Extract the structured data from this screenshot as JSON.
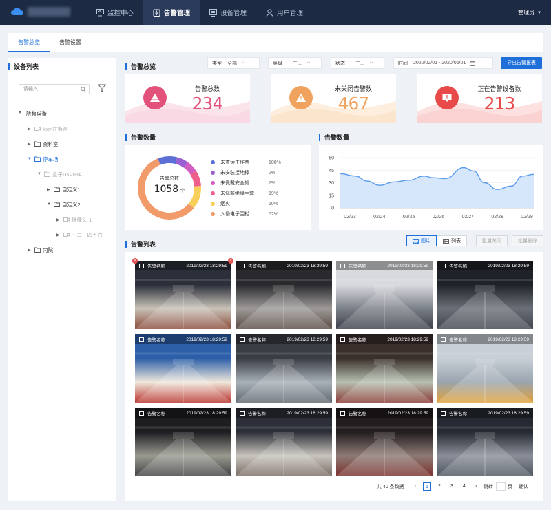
{
  "header": {
    "nav": [
      {
        "label": "监控中心",
        "icon": "monitor-icon"
      },
      {
        "label": "告警管理",
        "icon": "alarm-icon"
      },
      {
        "label": "设备管理",
        "icon": "device-icon"
      },
      {
        "label": "用户管理",
        "icon": "user-icon"
      }
    ],
    "active_index": 1,
    "user": "管理员"
  },
  "tabs": [
    "告警总览",
    "告警设置"
  ],
  "sidebar": {
    "title": "设备列表",
    "search_placeholder": "请输入",
    "tree": [
      {
        "label": "所有设备",
        "level": 0,
        "expanded": true
      },
      {
        "label": "Icon在监测",
        "level": 1,
        "dim": true
      },
      {
        "label": "资料室",
        "level": 1
      },
      {
        "label": "停车场",
        "level": 1,
        "expanded": true,
        "selected": true
      },
      {
        "label": "盒子DK203A",
        "level": 2,
        "dim": true,
        "expanded": true
      },
      {
        "label": "自定义1",
        "level": 3
      },
      {
        "label": "自定义2",
        "level": 3,
        "expanded": true
      },
      {
        "label": "摄像头-1",
        "level": 4,
        "dim": true
      },
      {
        "label": "一二三四五六",
        "level": 4,
        "dim": true
      },
      {
        "label": "内院",
        "level": 1
      }
    ]
  },
  "overview": {
    "title": "告警总览",
    "filters": [
      {
        "label": "类型",
        "value": "全部"
      },
      {
        "label": "等级",
        "value": "一三..."
      },
      {
        "label": "状态",
        "value": "一三..."
      }
    ],
    "time_label": "时间",
    "time_value": "2020/02/01 - 2020/06/01",
    "export": "导出告警报表",
    "kpis": [
      {
        "label": "告警总数",
        "value": "234",
        "color": "#e2527a"
      },
      {
        "label": "未关闭告警数",
        "value": "467",
        "color": "#f0a35f"
      },
      {
        "label": "正在告警设备数",
        "value": "213",
        "color": "#e84a4a"
      }
    ]
  },
  "donut": {
    "title": "告警数量",
    "center_label": "告警总数",
    "center_value": "1058",
    "center_unit": "个",
    "legend": [
      {
        "name": "未查读工作票",
        "pct": "100%",
        "color": "#5b6fd6"
      },
      {
        "name": "未安装接地棒",
        "pct": "2%",
        "color": "#9a5fd2"
      },
      {
        "name": "未佩戴安全帽",
        "pct": "7%",
        "color": "#d05fc0"
      },
      {
        "name": "未佩戴绝缘手套",
        "pct": "19%",
        "color": "#ee5f8a"
      },
      {
        "name": "烟火",
        "pct": "10%",
        "color": "#f7cf5a"
      },
      {
        "name": "入侵电子围栏",
        "pct": "52%",
        "color": "#f19a6a"
      }
    ]
  },
  "chart_data": {
    "type": "area",
    "title": "告警数量",
    "categories": [
      "02/23",
      "02/24",
      "02/25",
      "02/26",
      "02/27",
      "02/28",
      "02/29"
    ],
    "series": [
      {
        "values": [
          41,
          27,
          33,
          36,
          48,
          22,
          40
        ]
      }
    ],
    "ylim": [
      0,
      60
    ],
    "yticks": [
      "0",
      "15",
      "30",
      "45",
      "60"
    ],
    "grid": true
  },
  "list": {
    "title": "告警列表",
    "view_image": "图片",
    "view_list": "列表",
    "batch_close": "批量关闭",
    "batch_delete": "批量删除",
    "items": [
      {
        "name": "告警名称",
        "time": "2019/02/23 18:29:59"
      },
      {
        "name": "告警名称",
        "time": "2019/02/23 18:29:59"
      },
      {
        "name": "告警名称",
        "time": "2019/02/23 18:29:59"
      },
      {
        "name": "告警名称",
        "time": "2019/02/23 18:29:59"
      },
      {
        "name": "告警名称",
        "time": "2019/02/23 18:29:59"
      },
      {
        "name": "告警名称",
        "time": "2019/02/23 18:29:59"
      },
      {
        "name": "告警名称",
        "time": "2019/02/23 18:29:59"
      },
      {
        "name": "告警名称",
        "time": "2019/02/23 18:29:59"
      },
      {
        "name": "告警名称",
        "time": "2019/02/23 18:29:59"
      },
      {
        "name": "告警名称",
        "time": "2019/02/23 18:29:59"
      },
      {
        "name": "告警名称",
        "time": "2019/02/23 18:29:59"
      },
      {
        "name": "告警名称",
        "time": "2019/02/23 18:29:59"
      }
    ],
    "pagination": {
      "total": "共 40 条数据",
      "pages": [
        "1",
        "2",
        "3",
        "4"
      ],
      "jump": "跳转",
      "page_unit": "页",
      "confirm": "确认"
    }
  }
}
